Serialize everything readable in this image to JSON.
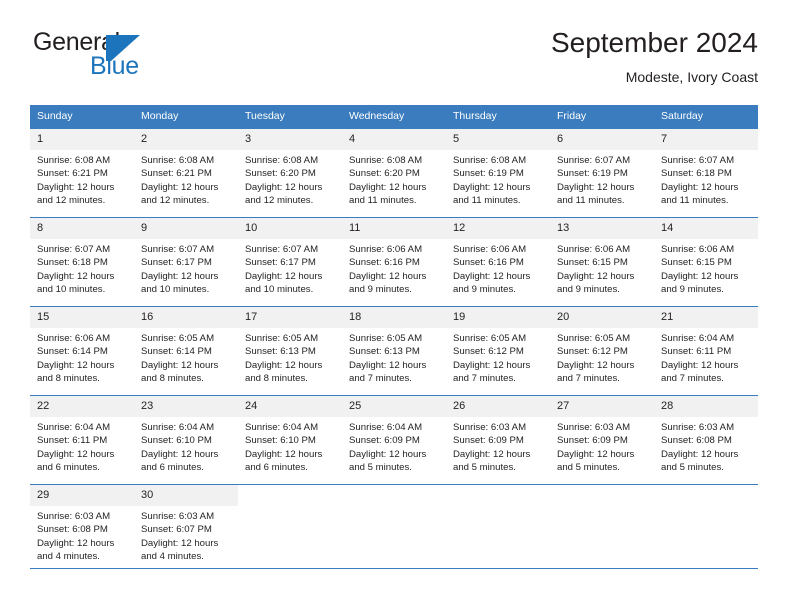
{
  "brand": {
    "name_part1": "General",
    "name_part2": "Blue",
    "logo_icon": "triangle-flag-icon"
  },
  "header": {
    "title": "September 2024",
    "subtitle": "Modeste, Ivory Coast"
  },
  "colors": {
    "header_blue": "#3a7cbe",
    "brand_blue": "#1c75bc",
    "daynum_bg": "#f1f1f1",
    "text": "#231f20"
  },
  "calendar": {
    "weekday_headers": [
      "Sunday",
      "Monday",
      "Tuesday",
      "Wednesday",
      "Thursday",
      "Friday",
      "Saturday"
    ],
    "labels": {
      "sunrise": "Sunrise:",
      "sunset": "Sunset:",
      "daylight": "Daylight:"
    },
    "weeks": [
      [
        {
          "day": "1",
          "sunrise": "Sunrise: 6:08 AM",
          "sunset": "Sunset: 6:21 PM",
          "daylight_line1": "Daylight: 12 hours",
          "daylight_line2": "and 12 minutes."
        },
        {
          "day": "2",
          "sunrise": "Sunrise: 6:08 AM",
          "sunset": "Sunset: 6:21 PM",
          "daylight_line1": "Daylight: 12 hours",
          "daylight_line2": "and 12 minutes."
        },
        {
          "day": "3",
          "sunrise": "Sunrise: 6:08 AM",
          "sunset": "Sunset: 6:20 PM",
          "daylight_line1": "Daylight: 12 hours",
          "daylight_line2": "and 12 minutes."
        },
        {
          "day": "4",
          "sunrise": "Sunrise: 6:08 AM",
          "sunset": "Sunset: 6:20 PM",
          "daylight_line1": "Daylight: 12 hours",
          "daylight_line2": "and 11 minutes."
        },
        {
          "day": "5",
          "sunrise": "Sunrise: 6:08 AM",
          "sunset": "Sunset: 6:19 PM",
          "daylight_line1": "Daylight: 12 hours",
          "daylight_line2": "and 11 minutes."
        },
        {
          "day": "6",
          "sunrise": "Sunrise: 6:07 AM",
          "sunset": "Sunset: 6:19 PM",
          "daylight_line1": "Daylight: 12 hours",
          "daylight_line2": "and 11 minutes."
        },
        {
          "day": "7",
          "sunrise": "Sunrise: 6:07 AM",
          "sunset": "Sunset: 6:18 PM",
          "daylight_line1": "Daylight: 12 hours",
          "daylight_line2": "and 11 minutes."
        }
      ],
      [
        {
          "day": "8",
          "sunrise": "Sunrise: 6:07 AM",
          "sunset": "Sunset: 6:18 PM",
          "daylight_line1": "Daylight: 12 hours",
          "daylight_line2": "and 10 minutes."
        },
        {
          "day": "9",
          "sunrise": "Sunrise: 6:07 AM",
          "sunset": "Sunset: 6:17 PM",
          "daylight_line1": "Daylight: 12 hours",
          "daylight_line2": "and 10 minutes."
        },
        {
          "day": "10",
          "sunrise": "Sunrise: 6:07 AM",
          "sunset": "Sunset: 6:17 PM",
          "daylight_line1": "Daylight: 12 hours",
          "daylight_line2": "and 10 minutes."
        },
        {
          "day": "11",
          "sunrise": "Sunrise: 6:06 AM",
          "sunset": "Sunset: 6:16 PM",
          "daylight_line1": "Daylight: 12 hours",
          "daylight_line2": "and 9 minutes."
        },
        {
          "day": "12",
          "sunrise": "Sunrise: 6:06 AM",
          "sunset": "Sunset: 6:16 PM",
          "daylight_line1": "Daylight: 12 hours",
          "daylight_line2": "and 9 minutes."
        },
        {
          "day": "13",
          "sunrise": "Sunrise: 6:06 AM",
          "sunset": "Sunset: 6:15 PM",
          "daylight_line1": "Daylight: 12 hours",
          "daylight_line2": "and 9 minutes."
        },
        {
          "day": "14",
          "sunrise": "Sunrise: 6:06 AM",
          "sunset": "Sunset: 6:15 PM",
          "daylight_line1": "Daylight: 12 hours",
          "daylight_line2": "and 9 minutes."
        }
      ],
      [
        {
          "day": "15",
          "sunrise": "Sunrise: 6:06 AM",
          "sunset": "Sunset: 6:14 PM",
          "daylight_line1": "Daylight: 12 hours",
          "daylight_line2": "and 8 minutes."
        },
        {
          "day": "16",
          "sunrise": "Sunrise: 6:05 AM",
          "sunset": "Sunset: 6:14 PM",
          "daylight_line1": "Daylight: 12 hours",
          "daylight_line2": "and 8 minutes."
        },
        {
          "day": "17",
          "sunrise": "Sunrise: 6:05 AM",
          "sunset": "Sunset: 6:13 PM",
          "daylight_line1": "Daylight: 12 hours",
          "daylight_line2": "and 8 minutes."
        },
        {
          "day": "18",
          "sunrise": "Sunrise: 6:05 AM",
          "sunset": "Sunset: 6:13 PM",
          "daylight_line1": "Daylight: 12 hours",
          "daylight_line2": "and 7 minutes."
        },
        {
          "day": "19",
          "sunrise": "Sunrise: 6:05 AM",
          "sunset": "Sunset: 6:12 PM",
          "daylight_line1": "Daylight: 12 hours",
          "daylight_line2": "and 7 minutes."
        },
        {
          "day": "20",
          "sunrise": "Sunrise: 6:05 AM",
          "sunset": "Sunset: 6:12 PM",
          "daylight_line1": "Daylight: 12 hours",
          "daylight_line2": "and 7 minutes."
        },
        {
          "day": "21",
          "sunrise": "Sunrise: 6:04 AM",
          "sunset": "Sunset: 6:11 PM",
          "daylight_line1": "Daylight: 12 hours",
          "daylight_line2": "and 7 minutes."
        }
      ],
      [
        {
          "day": "22",
          "sunrise": "Sunrise: 6:04 AM",
          "sunset": "Sunset: 6:11 PM",
          "daylight_line1": "Daylight: 12 hours",
          "daylight_line2": "and 6 minutes."
        },
        {
          "day": "23",
          "sunrise": "Sunrise: 6:04 AM",
          "sunset": "Sunset: 6:10 PM",
          "daylight_line1": "Daylight: 12 hours",
          "daylight_line2": "and 6 minutes."
        },
        {
          "day": "24",
          "sunrise": "Sunrise: 6:04 AM",
          "sunset": "Sunset: 6:10 PM",
          "daylight_line1": "Daylight: 12 hours",
          "daylight_line2": "and 6 minutes."
        },
        {
          "day": "25",
          "sunrise": "Sunrise: 6:04 AM",
          "sunset": "Sunset: 6:09 PM",
          "daylight_line1": "Daylight: 12 hours",
          "daylight_line2": "and 5 minutes."
        },
        {
          "day": "26",
          "sunrise": "Sunrise: 6:03 AM",
          "sunset": "Sunset: 6:09 PM",
          "daylight_line1": "Daylight: 12 hours",
          "daylight_line2": "and 5 minutes."
        },
        {
          "day": "27",
          "sunrise": "Sunrise: 6:03 AM",
          "sunset": "Sunset: 6:09 PM",
          "daylight_line1": "Daylight: 12 hours",
          "daylight_line2": "and 5 minutes."
        },
        {
          "day": "28",
          "sunrise": "Sunrise: 6:03 AM",
          "sunset": "Sunset: 6:08 PM",
          "daylight_line1": "Daylight: 12 hours",
          "daylight_line2": "and 5 minutes."
        }
      ],
      [
        {
          "day": "29",
          "sunrise": "Sunrise: 6:03 AM",
          "sunset": "Sunset: 6:08 PM",
          "daylight_line1": "Daylight: 12 hours",
          "daylight_line2": "and 4 minutes."
        },
        {
          "day": "30",
          "sunrise": "Sunrise: 6:03 AM",
          "sunset": "Sunset: 6:07 PM",
          "daylight_line1": "Daylight: 12 hours",
          "daylight_line2": "and 4 minutes."
        },
        {
          "day": "",
          "sunrise": "",
          "sunset": "",
          "daylight_line1": "",
          "daylight_line2": ""
        },
        {
          "day": "",
          "sunrise": "",
          "sunset": "",
          "daylight_line1": "",
          "daylight_line2": ""
        },
        {
          "day": "",
          "sunrise": "",
          "sunset": "",
          "daylight_line1": "",
          "daylight_line2": ""
        },
        {
          "day": "",
          "sunrise": "",
          "sunset": "",
          "daylight_line1": "",
          "daylight_line2": ""
        },
        {
          "day": "",
          "sunrise": "",
          "sunset": "",
          "daylight_line1": "",
          "daylight_line2": ""
        }
      ]
    ]
  }
}
